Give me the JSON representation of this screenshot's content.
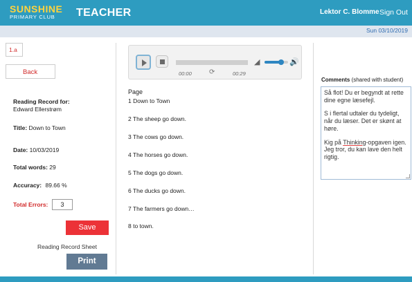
{
  "header": {
    "logo_main": "SUNSHINE",
    "logo_sub": "PRIMARY CLUB",
    "title": "TEACHER",
    "user": "Lektor C. Blomme",
    "signout": "Sign Out"
  },
  "date": "Sun 03/10/2019",
  "left": {
    "class_label": "1.a",
    "back_label": "Back",
    "reading_record_label": "Reading Record for:",
    "student_name": "Edward Ellerstrøm",
    "title_label": "Title:",
    "title_value": "Down to Town",
    "date_label": "Date:",
    "date_value": "10/03/2019",
    "total_words_label": "Total words:",
    "total_words_value": "29",
    "accuracy_label": "Accuracy:",
    "accuracy_value": "89.66 %",
    "total_errors_label": "Total Errors:",
    "total_errors_value": "3",
    "save_label": "Save",
    "sheet_label": "Reading Record Sheet",
    "print_label": "Print"
  },
  "player": {
    "current_time": "00:00",
    "duration": "00:29",
    "volume": 0.7,
    "progress": 0.0,
    "icons": {
      "play": "play-icon",
      "stop": "stop-icon",
      "loop": "loop-icon",
      "volume_low": "volume-low-icon",
      "volume_high": "volume-high-icon"
    }
  },
  "page": {
    "header": "Page",
    "lines": [
      "1 Down to Town",
      "2 The sheep go down.",
      "3 The cows go down.",
      "4 The horses go down.",
      "5 The dogs go down.",
      "6 The ducks go down.",
      "7 The farmers go down…",
      "8 to town."
    ]
  },
  "comments": {
    "label_bold": "Comments",
    "label_rest": " (shared with student)",
    "paragraphs": [
      "Så flot! Du er begyndt at rette dine egne læsefejl.",
      "S i flertal udtaler du tydeligt, når du læser. Det er skønt at høre.",
      "Kig på Thinking-opgaven igen. Jeg tror, du kan lave den helt rigtig."
    ]
  },
  "colors": {
    "header_bg": "#2e9cc0",
    "logo_yellow": "#ffd33d",
    "save_red": "#ec3237",
    "print_slate": "#617a93",
    "accent_red": "#d12a2a",
    "date_blue": "#2f6bb0"
  }
}
